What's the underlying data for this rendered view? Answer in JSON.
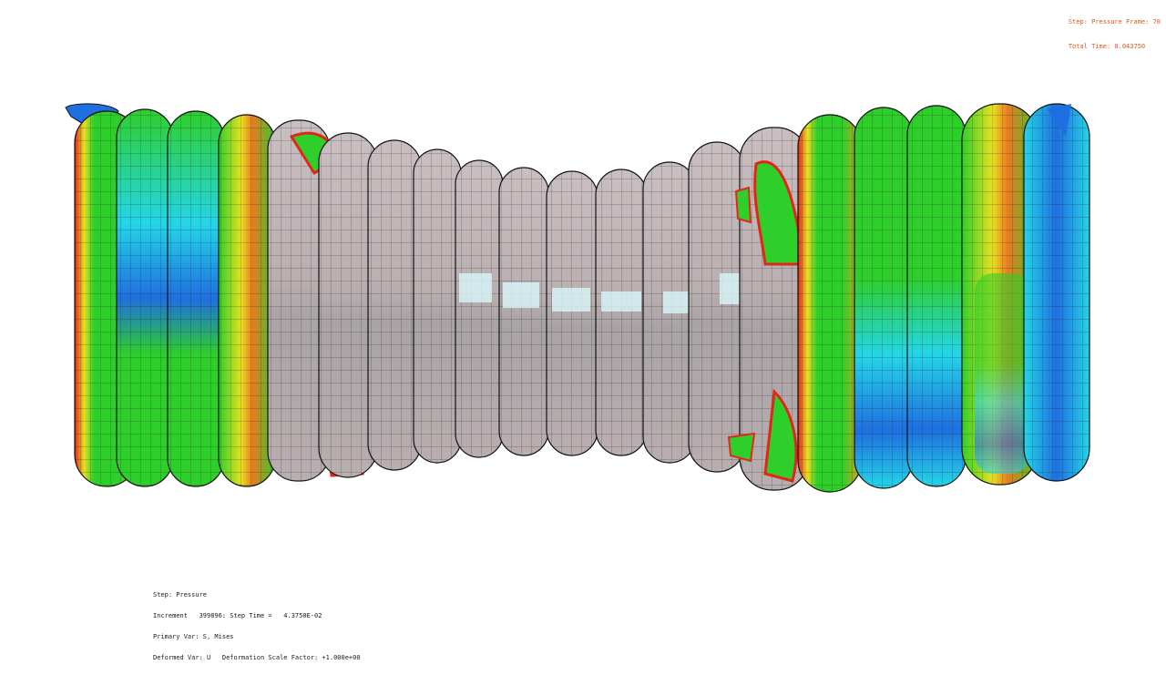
{
  "frame_info": {
    "step_frame": "Step: Pressure Frame: 70",
    "total_time": "Total Time: 0.043750"
  },
  "legend": {
    "step": "Step: Pressure",
    "increment": "Increment   399896: Step Time =   4.3750E-02",
    "primary_var": "Primary Var: S, Mises",
    "deformed_var": "Deformed Var: U   Deformation Scale Factor: +1.000e+00"
  },
  "colors": {
    "background": "#ffffff",
    "undeformed_gray": "#b9aeb0",
    "highlight_cyan": "#d8f6fa",
    "contour_green": "#2ecf2a",
    "contour_yellow": "#e8e021",
    "contour_red": "#e2261a",
    "contour_blue": "#1f6fe0",
    "contour_cyan": "#24d6e8",
    "hud_text": "#d9571c"
  },
  "rings": [
    {
      "name": "coil-ring-1",
      "color": "mixed-green-red"
    },
    {
      "name": "coil-ring-2",
      "color": "green-blue"
    },
    {
      "name": "coil-ring-3",
      "color": "green-blue"
    },
    {
      "name": "coil-ring-4",
      "color": "green-red"
    },
    {
      "name": "coil-ring-5",
      "color": "gray-red"
    },
    {
      "name": "coil-ring-6",
      "color": "gray-red"
    },
    {
      "name": "coil-ring-7",
      "color": "gray"
    },
    {
      "name": "coil-ring-8",
      "color": "gray"
    },
    {
      "name": "coil-ring-9",
      "color": "gray"
    },
    {
      "name": "coil-ring-10",
      "color": "gray"
    },
    {
      "name": "coil-ring-11",
      "color": "gray"
    },
    {
      "name": "coil-ring-12",
      "color": "gray"
    },
    {
      "name": "coil-ring-13",
      "color": "gray"
    },
    {
      "name": "coil-ring-14",
      "color": "gray-red"
    },
    {
      "name": "coil-ring-15",
      "color": "green-yellow"
    },
    {
      "name": "coil-ring-16",
      "color": "green-blue"
    },
    {
      "name": "coil-ring-17",
      "color": "green-blue"
    },
    {
      "name": "coil-ring-18",
      "color": "green-blue"
    },
    {
      "name": "coil-ring-19",
      "color": "yellow-blue"
    },
    {
      "name": "coil-ring-20",
      "color": "cyan-blue"
    }
  ]
}
